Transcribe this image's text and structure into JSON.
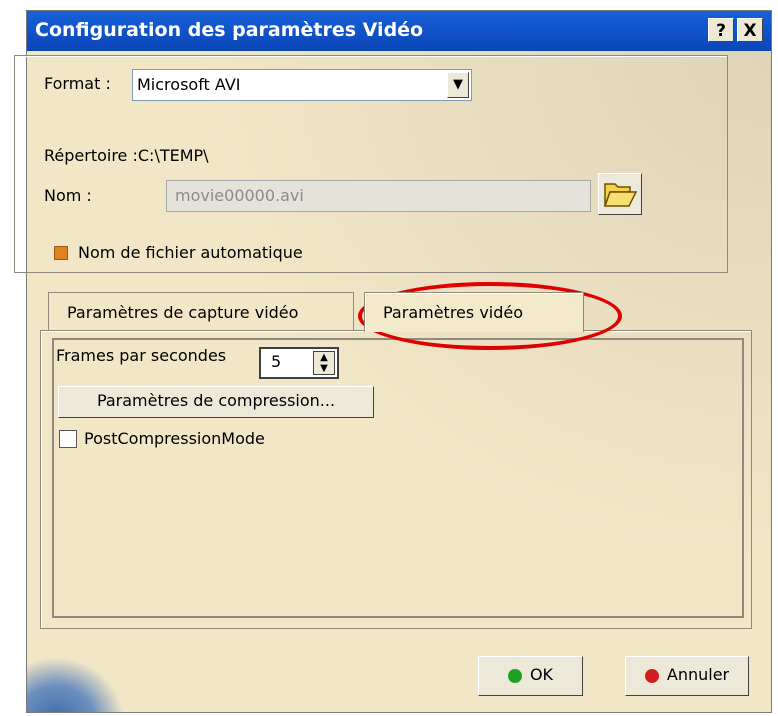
{
  "window": {
    "title": "Configuration des paramètres Vidéo",
    "help_label": "?",
    "close_label": "X"
  },
  "format": {
    "label": "Format :",
    "value": "Microsoft AVI"
  },
  "directory": {
    "label": "Répertoire :C:\\TEMP\\"
  },
  "name": {
    "label": "Nom :",
    "value": "movie00000.avi"
  },
  "auto_filename": {
    "label": "Nom de fichier automatique",
    "checked": true
  },
  "tabs": [
    {
      "label": "Paramètres de capture vidéo",
      "active": false
    },
    {
      "label": "Paramètres vidéo",
      "active": true
    }
  ],
  "video": {
    "fps_label": "Frames par secondes",
    "fps_value": "5",
    "compression_button": "Paramètres de compression...",
    "post_compression": {
      "label": "PostCompressionMode",
      "checked": false
    }
  },
  "buttons": {
    "ok": "OK",
    "cancel": "Annuler"
  },
  "colors": {
    "title_bar": "#0a46b8",
    "dialog_bg": "#f1e6c6",
    "highlight": "#e00000",
    "ok_dot": "#20a020",
    "cancel_dot": "#d02020"
  }
}
